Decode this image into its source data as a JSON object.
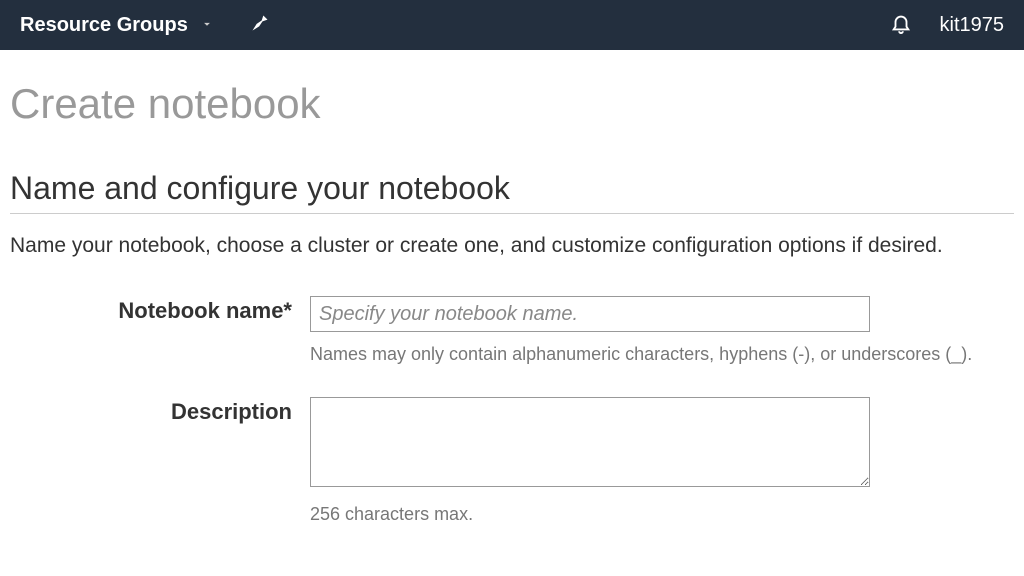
{
  "nav": {
    "resource_groups_label": "Resource Groups",
    "username": "kit1975"
  },
  "page": {
    "title": "Create notebook",
    "section_title": "Name and configure your notebook",
    "section_description": "Name your notebook, choose a cluster or create one, and customize configuration options if desired."
  },
  "form": {
    "name": {
      "label": "Notebook name*",
      "placeholder": "Specify your notebook name.",
      "help": "Names may only contain alphanumeric characters, hyphens (-), or underscores (_)."
    },
    "description": {
      "label": "Description",
      "help": "256 characters max."
    }
  }
}
